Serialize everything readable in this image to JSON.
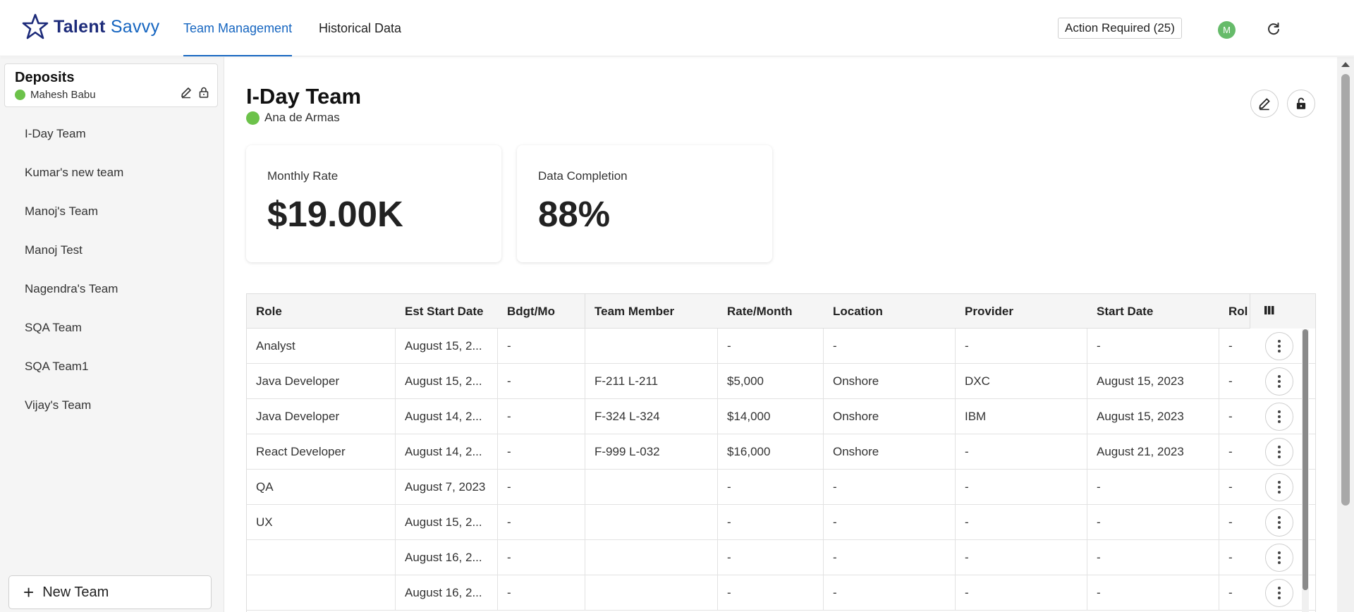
{
  "header": {
    "logo_part1": "Talent",
    "logo_part2": "Savvy",
    "tabs": [
      {
        "label": "Team Management",
        "active": true
      },
      {
        "label": "Historical Data",
        "active": false
      }
    ],
    "action_required": "Action Required (25)",
    "avatar_initial": "M",
    "icons": [
      "star-logo-icon",
      "refresh-icon"
    ]
  },
  "sidebar": {
    "department": {
      "title": "Deposits",
      "owner": "Mahesh Babu",
      "status_color": "#6cc24a",
      "icons": [
        "edit-icon",
        "lock-icon"
      ]
    },
    "teams": [
      "I-Day Team",
      "Kumar's new team",
      "Manoj's Team",
      "Manoj Test",
      "Nagendra's Team",
      "SQA Team",
      "SQA Team1",
      "Vijay's Team"
    ],
    "new_team_label": "New Team"
  },
  "main": {
    "team_title": "I-Day Team",
    "team_owner": "Ana de Armas",
    "metrics": [
      {
        "label": "Monthly Rate",
        "value": "$19.00K"
      },
      {
        "label": "Data Completion",
        "value": "88%"
      }
    ]
  },
  "table": {
    "columns": [
      "Role",
      "Est Start Date",
      "Bdgt/Mo",
      "Team Member",
      "Rate/Month",
      "Location",
      "Provider",
      "Start Date",
      "Rol"
    ],
    "rows": [
      [
        "Analyst",
        "August 15, 2...",
        "-",
        "",
        "-",
        "-",
        "-",
        "-",
        "-"
      ],
      [
        "Java Developer",
        "August 15, 2...",
        "-",
        "F-211 L-211",
        "$5,000",
        "Onshore",
        "DXC",
        "August 15, 2023",
        "-"
      ],
      [
        "Java Developer",
        "August 14, 2...",
        "-",
        "F-324 L-324",
        "$14,000",
        "Onshore",
        "IBM",
        "August 15, 2023",
        "-"
      ],
      [
        "React Developer",
        "August 14, 2...",
        "-",
        "F-999 L-032",
        "$16,000",
        "Onshore",
        "-",
        "August 21, 2023",
        "-"
      ],
      [
        "QA",
        "August 7, 2023",
        "-",
        "",
        "-",
        "-",
        "-",
        "-",
        "-"
      ],
      [
        "UX",
        "August 15, 2...",
        "-",
        "",
        "-",
        "-",
        "-",
        "-",
        "-"
      ],
      [
        "",
        "August 16, 2...",
        "-",
        "",
        "-",
        "-",
        "-",
        "-",
        "-"
      ],
      [
        "",
        "August 16, 2...",
        "-",
        "",
        "-",
        "-",
        "-",
        "-",
        "-"
      ]
    ]
  },
  "colors": {
    "accent": "#1565c0",
    "logo_dark": "#1d2b7a",
    "status_green": "#6cc24a",
    "avatar_green": "#66bb6a"
  }
}
